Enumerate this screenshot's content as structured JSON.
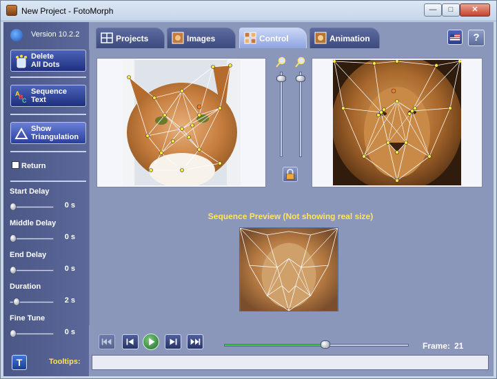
{
  "window": {
    "title": "New Project - FotoMorph",
    "minimize_glyph": "—",
    "maximize_glyph": "□",
    "close_glyph": "✕"
  },
  "app": {
    "version": "Version 10.2.2"
  },
  "sidebar": {
    "delete_dots_label_1": "Delete",
    "delete_dots_label_2": "All Dots",
    "sequence_text_label_1": "Sequence",
    "sequence_text_label_2": "Text",
    "show_triangulation_label_1": "Show",
    "show_triangulation_label_2": "Triangulation",
    "return_label": "Return",
    "return_checked": false,
    "delays": [
      {
        "label": "Start Delay",
        "value": "0 s",
        "level": 0.0
      },
      {
        "label": "Middle Delay",
        "value": "0 s",
        "level": 0.0
      },
      {
        "label": "End Delay",
        "value": "0 s",
        "level": 0.0
      },
      {
        "label": "Duration",
        "value": "2 s",
        "level": 0.1
      },
      {
        "label": "Fine Tune",
        "value": "0 s",
        "level": 0.0
      }
    ],
    "tooltips_icon_glyph": "T",
    "tooltips_label": "Tooltips:"
  },
  "tabs": [
    {
      "label": "Projects",
      "icon": "grid-icon",
      "active": false
    },
    {
      "label": "Images",
      "icon": "photo-icon",
      "active": false
    },
    {
      "label": "Control",
      "icon": "control-icon",
      "active": true
    },
    {
      "label": "Animation",
      "icon": "film-icon",
      "active": false
    }
  ],
  "help_glyph": "?",
  "preview": {
    "title": "Sequence Preview (Not showing real size)"
  },
  "playback": {
    "frame_label": "Frame:",
    "frame_value": "21",
    "progress": 0.55
  },
  "colors": {
    "accent": "#35d034",
    "highlight_text": "#ffe463",
    "panel": "#8a97bb"
  }
}
